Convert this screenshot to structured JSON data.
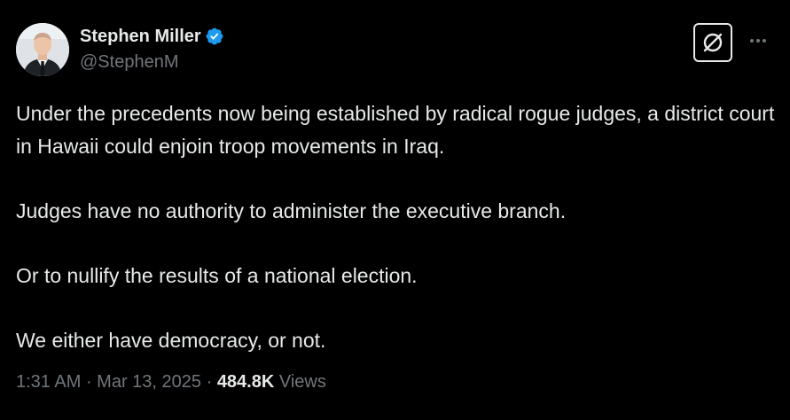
{
  "author": {
    "name": "Stephen Miller",
    "handle": "@StephenM",
    "verified_color": "#1d9bf0"
  },
  "toolbar": {
    "grok_icon": "grok-icon",
    "more_icon": "more-dots-icon"
  },
  "tweet": {
    "paragraphs": [
      "Under the precedents now being established by radical rogue judges, a district court in Hawaii could enjoin troop movements in Iraq.",
      "Judges have no authority to administer the executive branch.",
      "Or to nullify the results of a national election.",
      "We either have democracy, or not."
    ],
    "time": "1:31 AM",
    "sep1": " · ",
    "date": "Mar 13, 2025",
    "sep2": " · ",
    "views_count": "484.8K",
    "views_label": " Views"
  },
  "colors": {
    "background": "#000000",
    "text": "#e7e9ea",
    "muted": "#71767b"
  }
}
